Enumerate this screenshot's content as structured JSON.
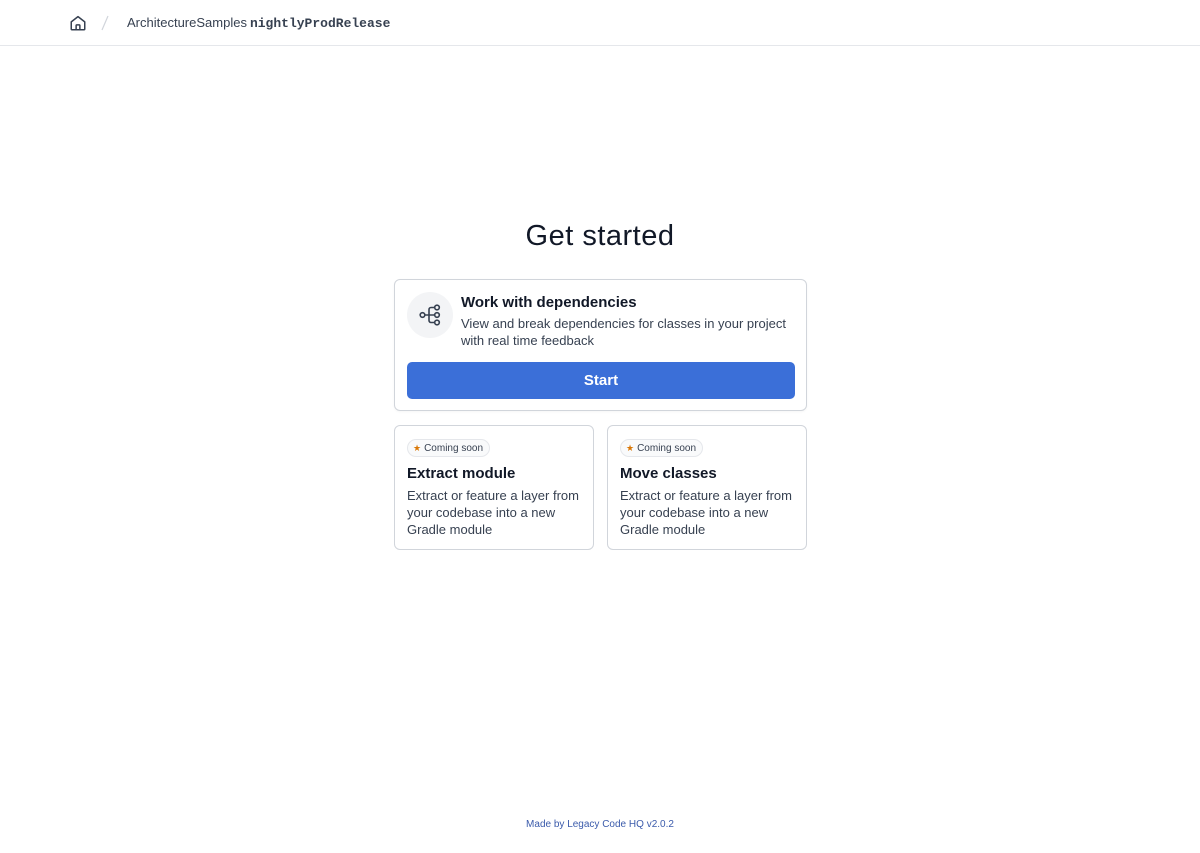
{
  "breadcrumb": {
    "home_icon": "home-icon",
    "separator": "/",
    "project": "ArchitectureSamples",
    "task": "nightlyProdRelease"
  },
  "main": {
    "heading": "Get started",
    "primary_card": {
      "icon": "dependency-tree-icon",
      "title": "Work with dependencies",
      "description": "View and break dependencies for classes in your project with real time feedback",
      "button_label": "Start",
      "button_color": "#3b6fd8"
    },
    "secondary_cards": [
      {
        "badge": "Coming soon",
        "badge_icon": "star-icon",
        "title": "Extract module",
        "description": "Extract or feature a layer from your codebase into a new Gradle module"
      },
      {
        "badge": "Coming soon",
        "badge_icon": "star-icon",
        "title": "Move classes",
        "description": "Extract or feature a layer from your codebase into a new Gradle module"
      }
    ]
  },
  "footer": {
    "prefix": "Made by",
    "link": "Legacy Code HQ",
    "version": "v2.0.2"
  }
}
